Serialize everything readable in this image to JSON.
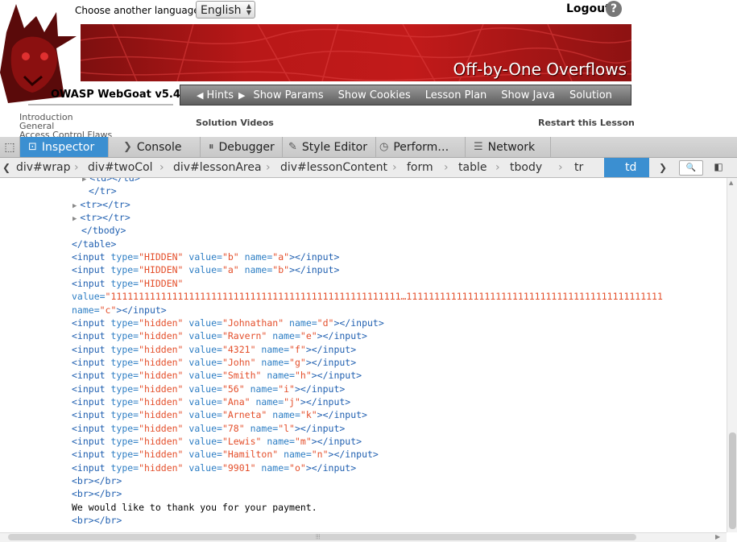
{
  "page": {
    "language_label": "Choose another language:",
    "language_value": "English",
    "logout": "Logout",
    "help": "?",
    "lesson_title": "Off-by-One Overflows",
    "brand": "OWASP WebGoat  v5.4",
    "nav": [
      "Hints",
      "Show Params",
      "Show Cookies",
      "Lesson Plan",
      "Show Java",
      "Solution"
    ],
    "menu": [
      "Introduction",
      "General",
      "Access Control Flaws"
    ],
    "solution_videos": "Solution Videos",
    "restart": "Restart this Lesson"
  },
  "devtools": {
    "tabs": [
      {
        "label": "Inspector",
        "icon": "inspector-icon"
      },
      {
        "label": "Console",
        "icon": "console-icon"
      },
      {
        "label": "Debugger",
        "icon": "debugger-icon"
      },
      {
        "label": "Style Editor",
        "icon": "style-editor-icon"
      },
      {
        "label": "Perform…",
        "icon": "performance-icon"
      },
      {
        "label": "Network",
        "icon": "network-icon"
      }
    ],
    "breadcrumbs": [
      "div#wrap",
      "div#twoCol",
      "div#lessonArea",
      "div#lessonContent",
      "form",
      "table",
      "tbody",
      "tr",
      "td"
    ],
    "markup": [
      {
        "indent": 114,
        "twisty": true,
        "parts": [
          [
            "tag",
            "<td>"
          ],
          [
            "tag",
            "</td>"
          ]
        ]
      },
      {
        "indent": 110,
        "parts": [
          [
            "tag",
            "</tr>"
          ]
        ]
      },
      {
        "indent": 102,
        "twisty": true,
        "parts": [
          [
            "tag",
            "<tr>"
          ],
          [
            "tag",
            "</tr>"
          ]
        ]
      },
      {
        "indent": 102,
        "twisty": true,
        "parts": [
          [
            "tag",
            "<tr>"
          ],
          [
            "tag",
            "</tr>"
          ]
        ]
      },
      {
        "indent": 101,
        "parts": [
          [
            "tag",
            "</tbody>"
          ]
        ]
      },
      {
        "indent": 89,
        "parts": [
          [
            "tag",
            "</table>"
          ]
        ]
      },
      {
        "indent": 89,
        "parts": [
          [
            "tag",
            "<input "
          ],
          [
            "attr",
            "type="
          ],
          [
            "val",
            "\"HIDDEN\" "
          ],
          [
            "attr",
            "value="
          ],
          [
            "val",
            "\"b\" "
          ],
          [
            "attr",
            "name="
          ],
          [
            "val",
            "\"a\""
          ],
          [
            "tag",
            "></input>"
          ]
        ]
      },
      {
        "indent": 89,
        "parts": [
          [
            "tag",
            "<input "
          ],
          [
            "attr",
            "type="
          ],
          [
            "val",
            "\"HIDDEN\" "
          ],
          [
            "attr",
            "value="
          ],
          [
            "val",
            "\"a\" "
          ],
          [
            "attr",
            "name="
          ],
          [
            "val",
            "\"b\""
          ],
          [
            "tag",
            "></input>"
          ]
        ]
      },
      {
        "indent": 89,
        "parts": [
          [
            "tag",
            "<input "
          ],
          [
            "attr",
            "type="
          ],
          [
            "val",
            "\"HIDDEN\""
          ]
        ]
      },
      {
        "indent": 89,
        "parts": [
          [
            "attr",
            "value="
          ],
          [
            "val",
            "\"1111111111111111111111111111111111111111111111111111…1111111111111111111111111111111111111111111111"
          ]
        ]
      },
      {
        "indent": 89,
        "parts": [
          [
            "attr",
            "name="
          ],
          [
            "val",
            "\"c\""
          ],
          [
            "tag",
            "></input>"
          ]
        ]
      },
      {
        "indent": 89,
        "parts": [
          [
            "tag",
            "<input "
          ],
          [
            "attr",
            "type="
          ],
          [
            "val",
            "\"hidden\" "
          ],
          [
            "attr",
            "value="
          ],
          [
            "val",
            "\"Johnathan\" "
          ],
          [
            "attr",
            "name="
          ],
          [
            "val",
            "\"d\""
          ],
          [
            "tag",
            "></input>"
          ]
        ]
      },
      {
        "indent": 89,
        "parts": [
          [
            "tag",
            "<input "
          ],
          [
            "attr",
            "type="
          ],
          [
            "val",
            "\"hidden\" "
          ],
          [
            "attr",
            "value="
          ],
          [
            "val",
            "\"Ravern\" "
          ],
          [
            "attr",
            "name="
          ],
          [
            "val",
            "\"e\""
          ],
          [
            "tag",
            "></input>"
          ]
        ]
      },
      {
        "indent": 89,
        "parts": [
          [
            "tag",
            "<input "
          ],
          [
            "attr",
            "type="
          ],
          [
            "val",
            "\"hidden\" "
          ],
          [
            "attr",
            "value="
          ],
          [
            "val",
            "\"4321\" "
          ],
          [
            "attr",
            "name="
          ],
          [
            "val",
            "\"f\""
          ],
          [
            "tag",
            "></input>"
          ]
        ]
      },
      {
        "indent": 89,
        "parts": [
          [
            "tag",
            "<input "
          ],
          [
            "attr",
            "type="
          ],
          [
            "val",
            "\"hidden\" "
          ],
          [
            "attr",
            "value="
          ],
          [
            "val",
            "\"John\" "
          ],
          [
            "attr",
            "name="
          ],
          [
            "val",
            "\"g\""
          ],
          [
            "tag",
            "></input>"
          ]
        ]
      },
      {
        "indent": 89,
        "parts": [
          [
            "tag",
            "<input "
          ],
          [
            "attr",
            "type="
          ],
          [
            "val",
            "\"hidden\" "
          ],
          [
            "attr",
            "value="
          ],
          [
            "val",
            "\"Smith\" "
          ],
          [
            "attr",
            "name="
          ],
          [
            "val",
            "\"h\""
          ],
          [
            "tag",
            "></input>"
          ]
        ]
      },
      {
        "indent": 89,
        "parts": [
          [
            "tag",
            "<input "
          ],
          [
            "attr",
            "type="
          ],
          [
            "val",
            "\"hidden\" "
          ],
          [
            "attr",
            "value="
          ],
          [
            "val",
            "\"56\" "
          ],
          [
            "attr",
            "name="
          ],
          [
            "val",
            "\"i\""
          ],
          [
            "tag",
            "></input>"
          ]
        ]
      },
      {
        "indent": 89,
        "parts": [
          [
            "tag",
            "<input "
          ],
          [
            "attr",
            "type="
          ],
          [
            "val",
            "\"hidden\" "
          ],
          [
            "attr",
            "value="
          ],
          [
            "val",
            "\"Ana\" "
          ],
          [
            "attr",
            "name="
          ],
          [
            "val",
            "\"j\""
          ],
          [
            "tag",
            "></input>"
          ]
        ]
      },
      {
        "indent": 89,
        "parts": [
          [
            "tag",
            "<input "
          ],
          [
            "attr",
            "type="
          ],
          [
            "val",
            "\"hidden\" "
          ],
          [
            "attr",
            "value="
          ],
          [
            "val",
            "\"Arneta\" "
          ],
          [
            "attr",
            "name="
          ],
          [
            "val",
            "\"k\""
          ],
          [
            "tag",
            "></input>"
          ]
        ]
      },
      {
        "indent": 89,
        "parts": [
          [
            "tag",
            "<input "
          ],
          [
            "attr",
            "type="
          ],
          [
            "val",
            "\"hidden\" "
          ],
          [
            "attr",
            "value="
          ],
          [
            "val",
            "\"78\" "
          ],
          [
            "attr",
            "name="
          ],
          [
            "val",
            "\"l\""
          ],
          [
            "tag",
            "></input>"
          ]
        ]
      },
      {
        "indent": 89,
        "parts": [
          [
            "tag",
            "<input "
          ],
          [
            "attr",
            "type="
          ],
          [
            "val",
            "\"hidden\" "
          ],
          [
            "attr",
            "value="
          ],
          [
            "val",
            "\"Lewis\" "
          ],
          [
            "attr",
            "name="
          ],
          [
            "val",
            "\"m\""
          ],
          [
            "tag",
            "></input>"
          ]
        ]
      },
      {
        "indent": 89,
        "parts": [
          [
            "tag",
            "<input "
          ],
          [
            "attr",
            "type="
          ],
          [
            "val",
            "\"hidden\" "
          ],
          [
            "attr",
            "value="
          ],
          [
            "val",
            "\"Hamilton\" "
          ],
          [
            "attr",
            "name="
          ],
          [
            "val",
            "\"n\""
          ],
          [
            "tag",
            "></input>"
          ]
        ]
      },
      {
        "indent": 89,
        "parts": [
          [
            "tag",
            "<input "
          ],
          [
            "attr",
            "type="
          ],
          [
            "val",
            "\"hidden\" "
          ],
          [
            "attr",
            "value="
          ],
          [
            "val",
            "\"9901\" "
          ],
          [
            "attr",
            "name="
          ],
          [
            "val",
            "\"o\""
          ],
          [
            "tag",
            "></input>"
          ]
        ]
      },
      {
        "indent": 89,
        "parts": [
          [
            "tag",
            "<br>"
          ],
          [
            "tag",
            "</br>"
          ]
        ]
      },
      {
        "indent": 89,
        "parts": [
          [
            "tag",
            "<br>"
          ],
          [
            "tag",
            "</br>"
          ]
        ]
      },
      {
        "indent": 89,
        "parts": [
          [
            "txt",
            "We would like to thank you for your payment."
          ]
        ]
      },
      {
        "indent": 89,
        "parts": [
          [
            "tag",
            "<br>"
          ],
          [
            "tag",
            "</br>"
          ]
        ]
      }
    ]
  }
}
